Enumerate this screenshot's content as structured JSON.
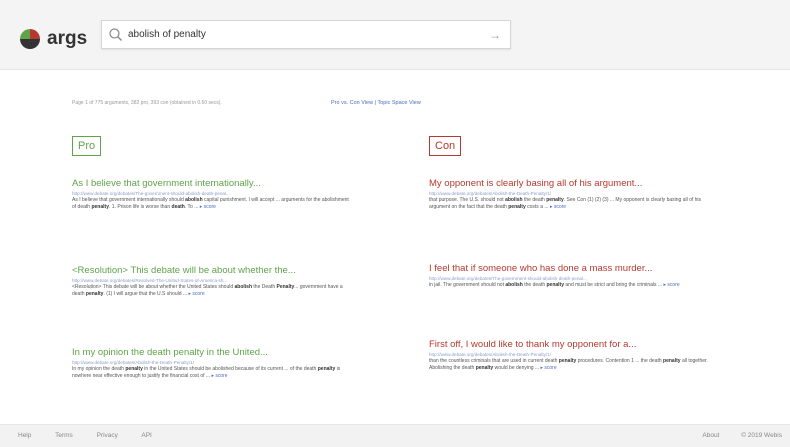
{
  "brand": {
    "name": "args"
  },
  "search": {
    "query": "abolish of penalty",
    "submit_icon": "arrow-right-icon"
  },
  "stats": "Page 1 of 775 arguments, 382 pro, 393 con (obtained in 0.60 secs).",
  "views": {
    "pro_vs_con": "Pro vs. Con View",
    "separator": " | ",
    "topic_space": "Topic Space View"
  },
  "columns": {
    "pro": "Pro",
    "con": "Con"
  },
  "results": {
    "pro": [
      {
        "title": "As I believe that government internationally...",
        "url": "http://www.debate.org/debates/The-government-should-abolish-death-penal...",
        "snippet_parts": [
          "As I believe that government internationally should ",
          "abolish",
          " capital punishment. I will accept ... arguments for the abolishment of death ",
          "penalty",
          ". 1. Prison life is worse than ",
          "death",
          ". To ..."
        ],
        "score": "score"
      },
      {
        "title": "<Resolution> This debate will be about whether the...",
        "url": "http://www.debate.org/debates/Resolved-The-United-States-of-America-sh...",
        "snippet_parts": [
          "<Resolution> This debate will be about whether the United States should ",
          "abolish",
          " the Death ",
          "Penalty",
          "... government have a death ",
          "penalty",
          ". (1) I will argue that the U.S should ..."
        ],
        "score": "score"
      },
      {
        "title": "In my opinion the death penalty in the United...",
        "url": "http://www.debate.org/debates/Abolish-the-Death-Penalty/1/",
        "snippet_parts": [
          "In my opinion the death ",
          "penalty",
          " in the United States should be abolished because of its current ... of the death ",
          "penalty",
          " is nowhere near effective enough to justify the financial cost of ..."
        ],
        "score": "score"
      }
    ],
    "con": [
      {
        "title": "My opponent is clearly basing all of his argument...",
        "url": "http://www.debate.org/debates/Abolish-the-Death-Penalty/1/",
        "snippet_parts": [
          "that purpose. The U.S. should not ",
          "abolish",
          " the death ",
          "penalty",
          ". See Con (1) (2) (3) ... My opponent is clearly basing all of his argument on the fact that the death ",
          "penalty",
          " costs a ..."
        ],
        "score": "score"
      },
      {
        "title": "I feel that if someone who has done a mass murder...",
        "url": "http://www.debate.org/debates/The-government-should-abolish-death-penal...",
        "snippet_parts": [
          "in jail. The government should not ",
          "abolish",
          " the death ",
          "penalty",
          " and must be strict and bring the criminals ..."
        ],
        "score": "score"
      },
      {
        "title": "First off, I would like to thank my opponent for a...",
        "url": "http://www.debate.org/debates/Abolish-the-Death-Penalty/1/",
        "snippet_parts": [
          "than the countless criminals that are used in current death ",
          "penalty",
          " procedures. Contention 1 ... the death ",
          "penalty",
          " all together. Abolishing the death ",
          "penalty",
          " would be denying ..."
        ],
        "score": "score"
      }
    ]
  },
  "footer": {
    "links": [
      "Help",
      "Terms",
      "Privacy",
      "API"
    ],
    "about": "About",
    "copyright": "© 2019 Webis"
  },
  "colors": {
    "pro": "#5fa34a",
    "con": "#b5392e",
    "link": "#4a6bc1"
  }
}
